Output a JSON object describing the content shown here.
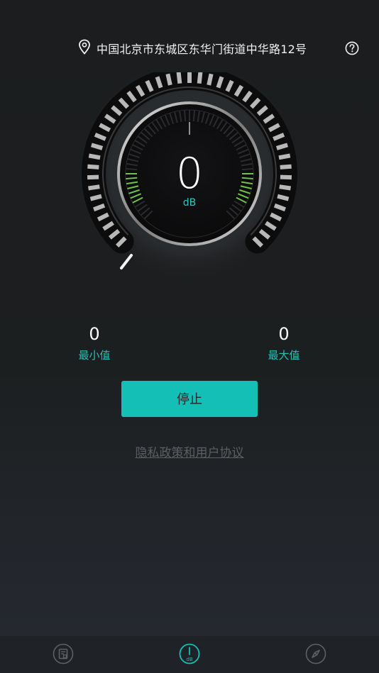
{
  "location": {
    "text": "中国北京市东城区东华门街道中华路12号",
    "icon": "location-pin-icon"
  },
  "help": {
    "icon": "help-icon"
  },
  "gauge": {
    "value": "0",
    "unit": "dB"
  },
  "stats": {
    "min_value": "0",
    "min_label": "最小值",
    "max_value": "0",
    "max_label": "最大值"
  },
  "stop_button": {
    "label": "停止"
  },
  "privacy_link": {
    "label": "隐私政策和用户协议"
  },
  "bottom_nav": {
    "items": [
      {
        "icon": "records-icon",
        "active": false
      },
      {
        "icon": "decibel-meter-icon",
        "label": "dB",
        "active": true
      },
      {
        "icon": "compass-icon",
        "active": false
      }
    ]
  },
  "colors": {
    "accent": "#14bfb5",
    "accent_text": "#26c0b6",
    "meter_green": "#6fc24a",
    "inactive_icon": "#5c6166"
  }
}
